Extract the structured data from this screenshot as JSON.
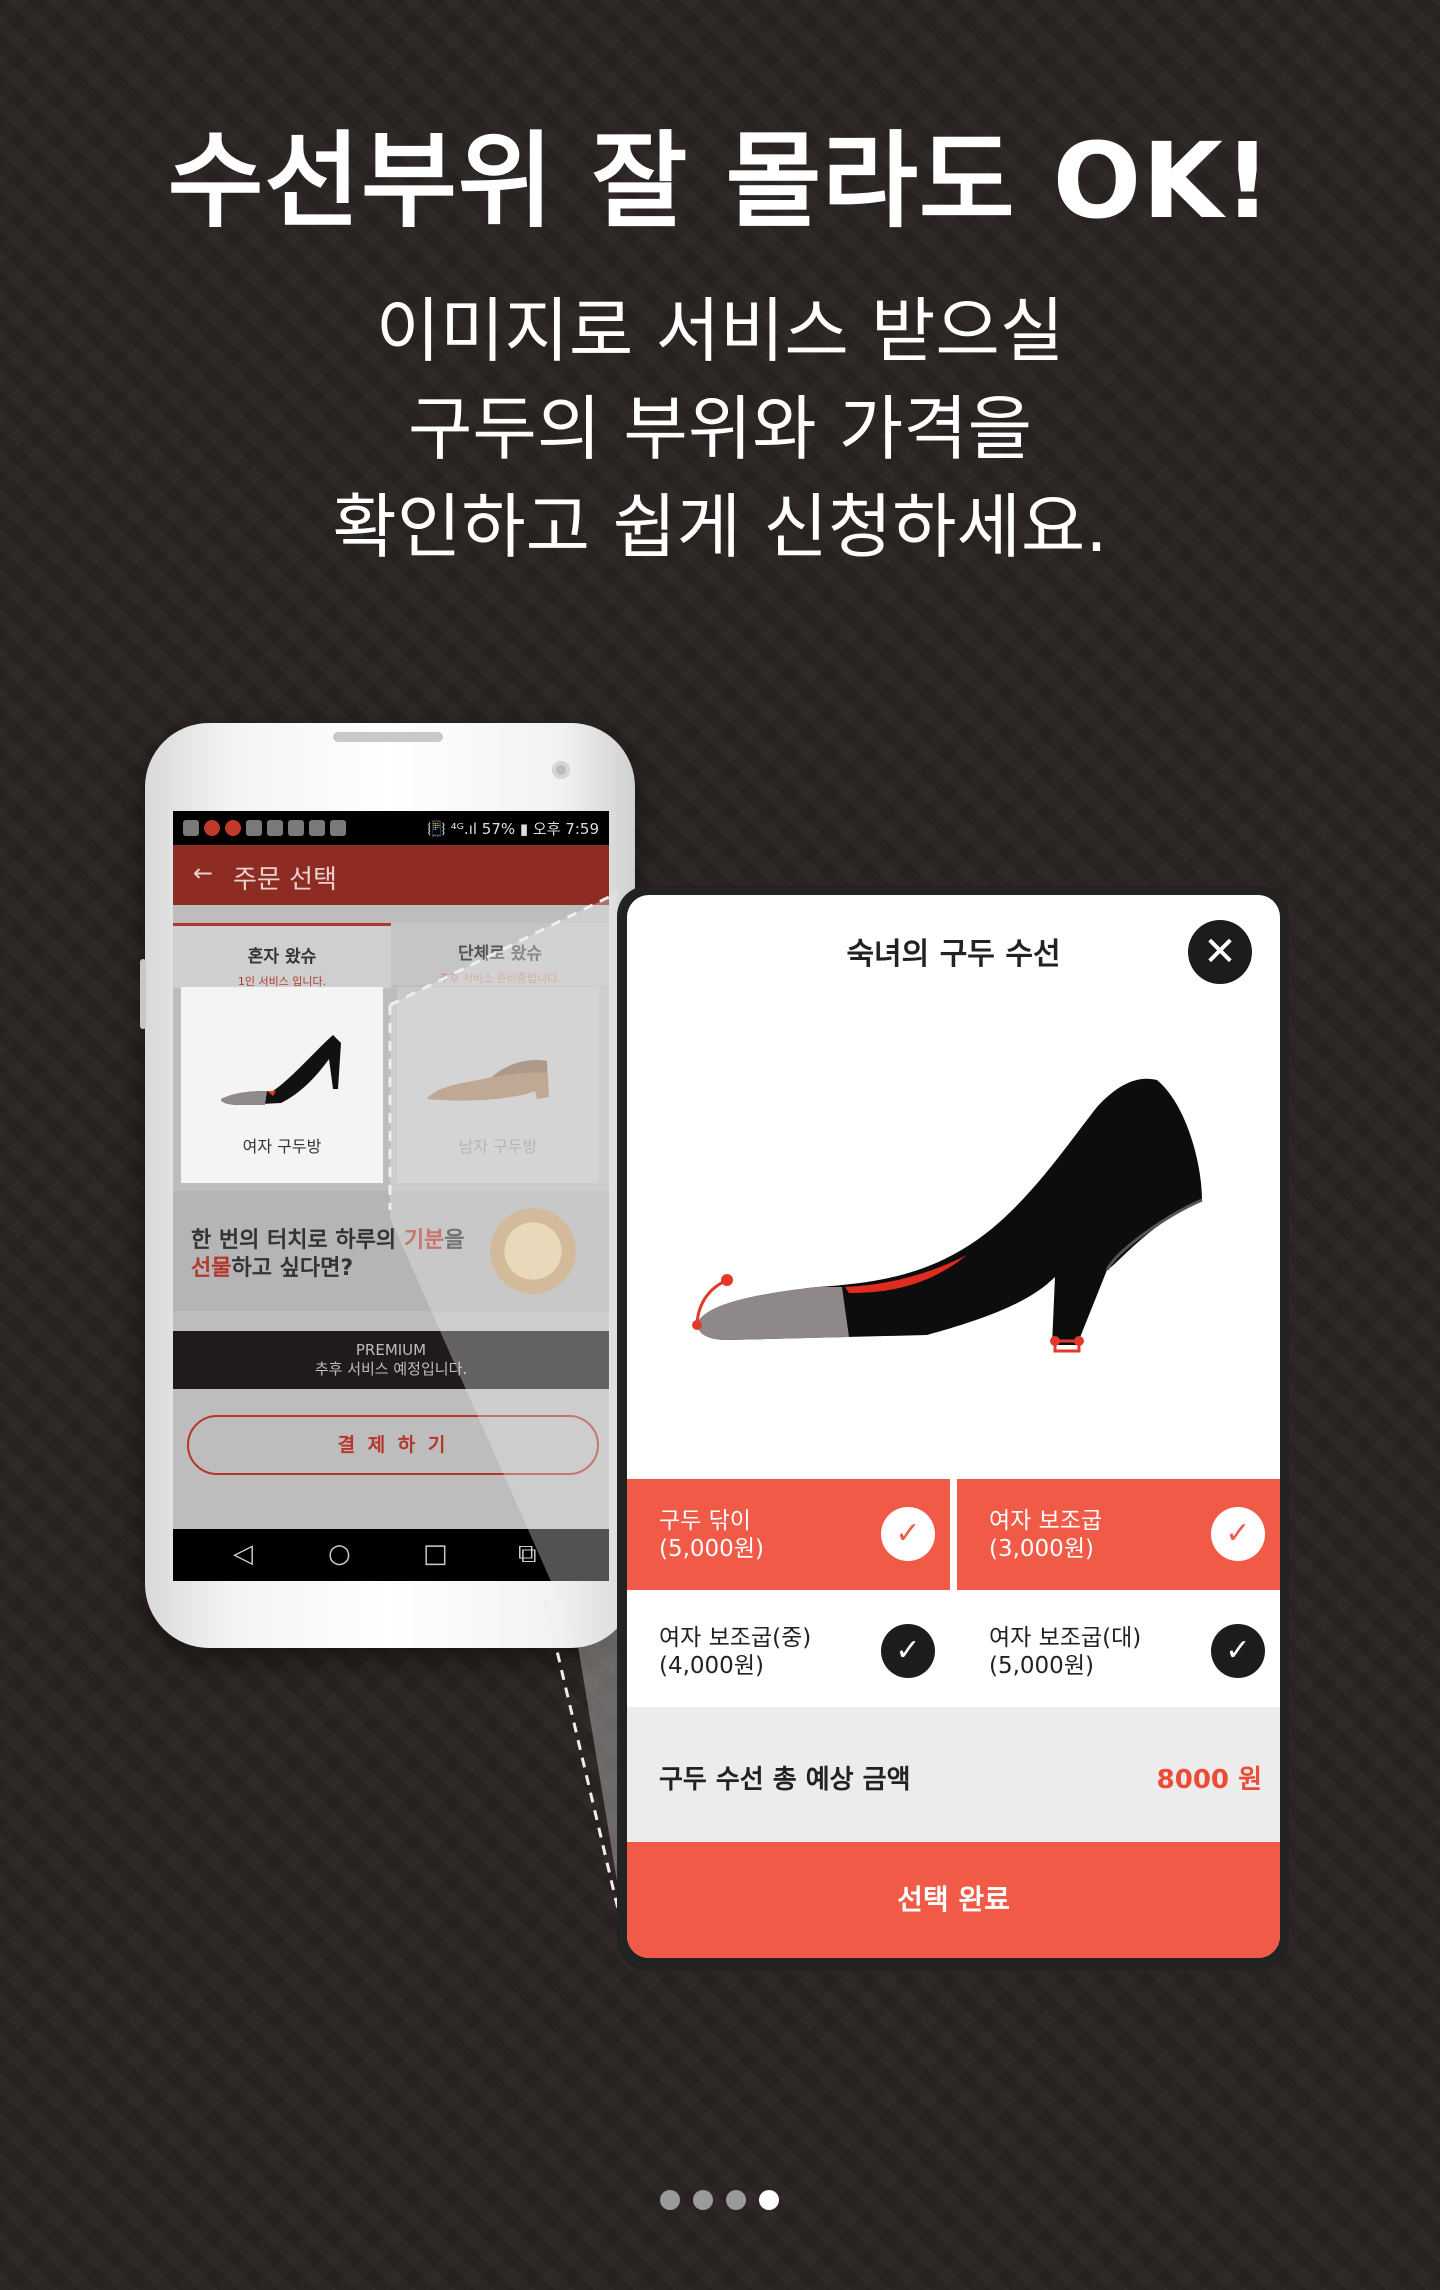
{
  "headline": "수선부위 잘 몰라도 OK!",
  "subtext": {
    "line1": "이미지로 서비스 받으실",
    "line2": "구두의 부위와 가격을",
    "line3": "확인하고 쉽게 신청하세요."
  },
  "phone": {
    "status_right": "📳 ⁴ᴳ.ıl 57% ▮ 오후 7:59",
    "appbar": {
      "back_icon": "arrow-left-icon",
      "title": "주문 선택"
    },
    "tabs": [
      {
        "title": "혼자 왔슈",
        "subtitle": "1인 서비스 입니다."
      },
      {
        "title": "단체로 왔슈",
        "subtitle": "추후 서비스 준비중입니다."
      }
    ],
    "cards": [
      {
        "label": "여자 구두방"
      },
      {
        "label": "남자 구두방"
      }
    ],
    "banner": {
      "line1_a": "한 번의 터치로 하루의 ",
      "line1_hl": "기분",
      "line1_b": "을",
      "line2_hl": "선물",
      "line2_b": "하고 싶다면?"
    },
    "premium": {
      "line1": "PREMIUM",
      "line2": "추후 서비스 예정입니다."
    },
    "pay_button": "결 제 하 기"
  },
  "modal": {
    "title": "숙녀의 구두 수선",
    "close_icon": "close-icon",
    "options": [
      {
        "name": "구두 닦이",
        "price": "(5,000원)",
        "selected": true
      },
      {
        "name": "여자 보조굽",
        "price": "(3,000원)",
        "selected": true
      },
      {
        "name": "여자 보조굽(중)",
        "price": "(4,000원)",
        "selected": false
      },
      {
        "name": "여자 보조굽(대)",
        "price": "(5,000원)",
        "selected": false
      }
    ],
    "total_label": "구두 수선 총 예상 금액",
    "total_value": "8000 원",
    "confirm_button": "선택 완료"
  },
  "pagination": {
    "count": 4,
    "active_index": 3
  },
  "colors": {
    "accent": "#f05a47",
    "appbar": "#8e2c24",
    "background": "#2a2422"
  }
}
